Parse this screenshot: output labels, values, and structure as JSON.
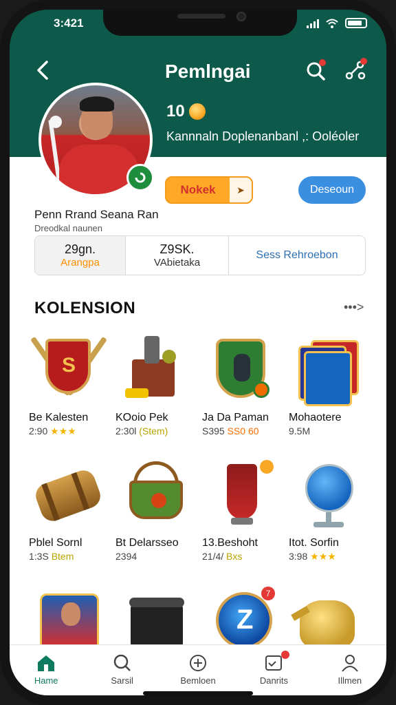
{
  "status_bar": {
    "time": "3:421"
  },
  "header": {
    "title": "Pemlngai",
    "points": "10",
    "subtitle": "Kannnaln Doplenanbanl ,: Ooléoler",
    "primary_button_label": "Nokek",
    "secondary_button_label": "Deseoun"
  },
  "profile": {
    "name": "Penn Rrand Seana Ran",
    "subtitle": "Dreodkal naunen"
  },
  "stats": [
    {
      "value": "29gn.",
      "label": "Arangpa"
    },
    {
      "value": "Z9SK.",
      "label": "VAbietaka"
    },
    {
      "value": "",
      "label": "Sess Rehroebon"
    }
  ],
  "collection": {
    "title": "KOLENSION",
    "more_label": "•••>",
    "items": [
      {
        "name": "Be Kalesten",
        "meta_prefix": "2:90",
        "meta_suffix": "★★★",
        "icon": "shield-icon"
      },
      {
        "name": "KOoio Pek",
        "meta_prefix": "2:30l",
        "meta_suffix": "(Stem)",
        "icon": "treasure-box-icon"
      },
      {
        "name": "Ja Da Paman",
        "meta_prefix": "S395",
        "meta_suffix": "SS0 60",
        "icon": "team-badge-icon"
      },
      {
        "name": "Mohaotere",
        "meta_prefix": "9.5M",
        "meta_suffix": "",
        "icon": "card-pack-icon"
      },
      {
        "name": "Pblel Sornl",
        "meta_prefix": "1:3S",
        "meta_suffix": "Btem",
        "icon": "barrel-icon"
      },
      {
        "name": "Bt Delarsseo",
        "meta_prefix": "2394",
        "meta_suffix": "",
        "icon": "pot-icon"
      },
      {
        "name": "13.Beshoht",
        "meta_prefix": "21/4/",
        "meta_suffix": "Bxs",
        "icon": "vase-icon"
      },
      {
        "name": "Itot. Sorfin",
        "meta_prefix": "3:98",
        "meta_suffix": "★★★",
        "icon": "globe-icon"
      },
      {
        "name": "",
        "meta_prefix": "",
        "meta_suffix": "",
        "icon": "player-card-icon"
      },
      {
        "name": "",
        "meta_prefix": "",
        "meta_suffix": "",
        "icon": "black-jar-icon"
      },
      {
        "name": "",
        "meta_prefix": "",
        "meta_suffix": "",
        "icon": "blue-coin-icon",
        "badge": "7"
      },
      {
        "name": "",
        "meta_prefix": "",
        "meta_suffix": "",
        "icon": "teapot-icon"
      }
    ]
  },
  "bottom_nav": [
    {
      "label": "Hame",
      "icon": "home-icon",
      "active": true
    },
    {
      "label": "Sarsil",
      "icon": "search-icon",
      "active": false
    },
    {
      "label": "Bemloen",
      "icon": "plus-circle-icon",
      "active": false
    },
    {
      "label": "Danrits",
      "icon": "inbox-icon",
      "active": false
    },
    {
      "label": "Illmen",
      "icon": "user-icon",
      "active": false
    }
  ],
  "colors": {
    "header_bg": "#0e5a4a",
    "accent_orange": "#ffa726",
    "accent_blue": "#3b8fe0",
    "star": "#f5b400"
  }
}
